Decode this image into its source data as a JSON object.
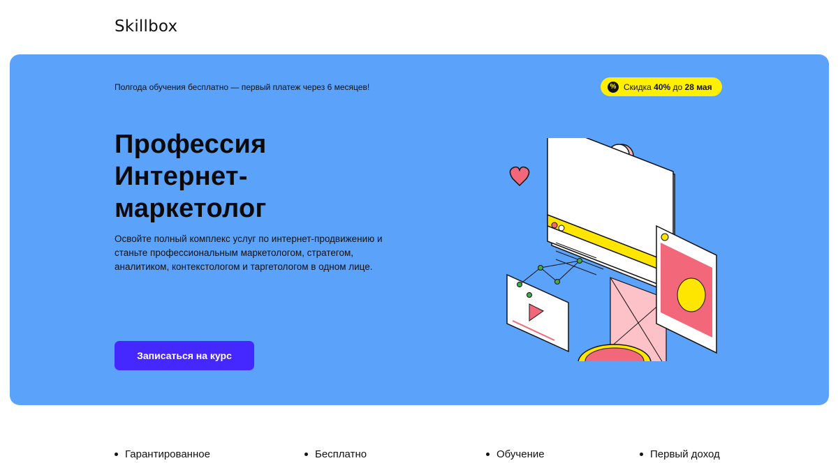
{
  "header": {
    "logo_text": "Skillbox"
  },
  "hero": {
    "promo_text": "Полгода обучения бесплатно — первый платеж через 6 месяцев!",
    "discount": {
      "prefix": "Скидка ",
      "amount": "40%",
      "middle": " до ",
      "date": "28 мая",
      "icon": "percent-icon"
    },
    "title_lines": [
      "Профессия",
      "Интернет-",
      "маркетолог"
    ],
    "description": "Освойте полный комплекс услуг по интернет-продвижению и станьте профессиональным маркетологом, стратегом, аналитиком, контекстологом и таргетологом в одном лице.",
    "cta_label": "Записаться на курс"
  },
  "features": [
    {
      "label": "Гарантированное"
    },
    {
      "label": "Бесплатно"
    },
    {
      "label": "Обучение"
    },
    {
      "label": "Первый доход"
    }
  ],
  "colors": {
    "hero_bg": "#5ba2fb",
    "cta_bg": "#4527ff",
    "badge_bg": "#fff000"
  }
}
